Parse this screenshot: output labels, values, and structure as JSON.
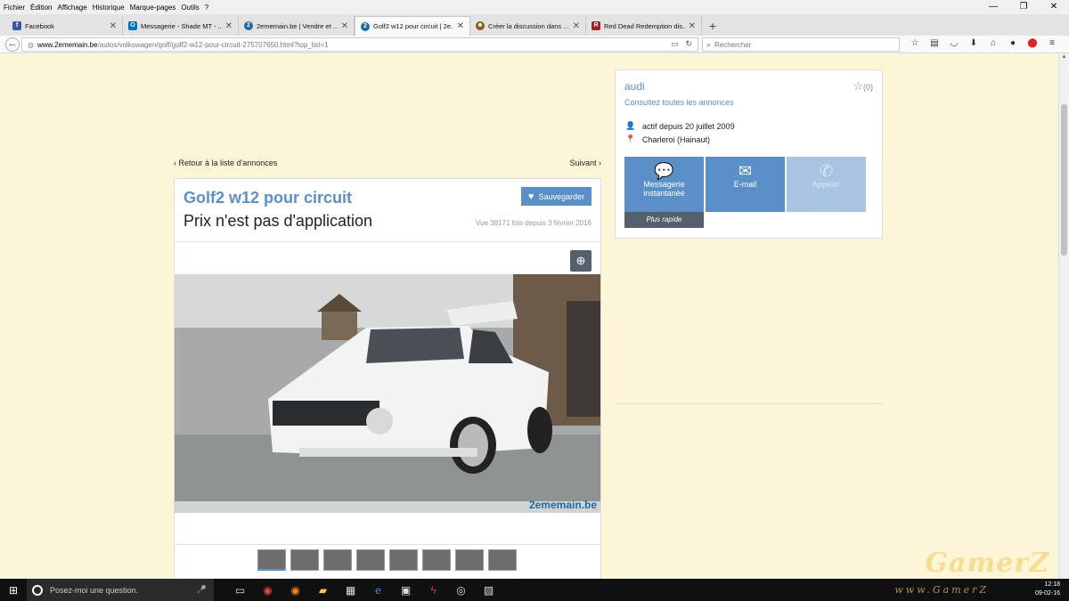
{
  "menu": [
    "Fichier",
    "Édition",
    "Affichage",
    "Historique",
    "Marque-pages",
    "Outils",
    "?"
  ],
  "window_controls": [
    "—",
    "❐",
    "✕"
  ],
  "tabs": [
    {
      "label": "Facebook",
      "icon": "facebook-icon",
      "color": "#3b5998"
    },
    {
      "label": "Messagerie - Shade MT - ...",
      "icon": "outlook-icon",
      "color": "#0072c6"
    },
    {
      "label": "2ememain.be | Vendre et ...",
      "icon": "2ememain-icon",
      "color": "#1d6aa5"
    },
    {
      "label": "Golf2 w12 pour circuit | 2e...",
      "icon": "2ememain-icon",
      "color": "#1d6aa5"
    },
    {
      "label": "Créer la discussion dans ...",
      "icon": "forum-icon",
      "color": "#8a5a1e"
    },
    {
      "label": "Red Dead Redemption dis...",
      "icon": "rdr-icon",
      "color": "#a32020"
    }
  ],
  "url": {
    "host": "www.2ememain.be",
    "path": "/autos/volkswagen/golf/golf2-w12-pour-circuit-275707650.html?top_list=1"
  },
  "search": {
    "placeholder": "Rechercher"
  },
  "listing": {
    "back": "Retour à la liste d'annonces",
    "next": "Suivant",
    "title": "Golf2 w12 pour circuit",
    "price": "Prix n'est pas d'application",
    "save": "Sauvegarder",
    "views": "Vue 38171 fois depuis 3 février 2016",
    "watermark": "2ememain.be",
    "thumbnail_count": 8
  },
  "seller": {
    "name": "audi",
    "all_ads": "Consultez toutes les annonces",
    "favorites": "(0)",
    "since": "actif depuis 20 juillet 2009",
    "location": "Charleroi (Hainaut)",
    "btn_message": "Messagerie instantanée",
    "btn_email": "E-mail",
    "btn_call": "Appeler",
    "fast": "Plus rapide"
  },
  "taskbar": {
    "search_placeholder": "Posez-moi une question.",
    "time": "12:18",
    "date": "09-02-16"
  },
  "watermark": {
    "title": "GamerZ",
    "sub": "www.GamerZ"
  },
  "colors": {
    "accent": "#5b8fc7",
    "page_bg": "#fdf5d8",
    "taskbar": "#101010"
  }
}
